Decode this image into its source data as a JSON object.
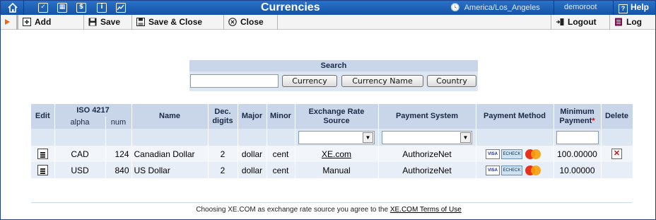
{
  "topbar": {
    "icons": [
      "home-icon",
      "checkbox-icon",
      "grid-icon",
      "dollar-icon",
      "info-icon",
      "chart-icon"
    ],
    "title": "Currencies",
    "timezone": "America/Los_Angeles",
    "user": "demoroot",
    "help": "Help",
    "background": "#1a5fb4"
  },
  "toolbar": {
    "add": "Add",
    "save": "Save",
    "save_close": "Save & Close",
    "close": "Close",
    "logout": "Logout",
    "log": "Log",
    "accent": "#e86a0c"
  },
  "search": {
    "title": "Search",
    "input_value": "",
    "buttons": [
      "Currency",
      "Currency Name",
      "Country"
    ]
  },
  "table": {
    "headers": {
      "edit": "Edit",
      "iso": "ISO 4217",
      "alpha": "alpha",
      "num": "num",
      "name": "Name",
      "dec": "Dec. digits",
      "major": "Major",
      "minor": "Minor",
      "rate_source": "Exchange Rate Source",
      "payment_system": "Payment System",
      "payment_method": "Payment Method",
      "minimum_payment": "Minimum Payment",
      "required_mark": "*",
      "delete": "Delete"
    },
    "rows": [
      {
        "alpha": "CAD",
        "num": "124",
        "name": "Canadian Dollar",
        "dec": "2",
        "major": "dollar",
        "minor": "cent",
        "rate_source": "XE.com",
        "payment_system": "AuthorizeNet",
        "minimum_payment": "100.00000",
        "deletable": true
      },
      {
        "alpha": "USD",
        "num": "840",
        "name": "US Dollar",
        "dec": "2",
        "major": "dollar",
        "minor": "cent",
        "rate_source": "Manual",
        "payment_system": "AuthorizeNet",
        "minimum_payment": "10.00000",
        "deletable": false
      }
    ],
    "payment_method_labels": {
      "visa": "VISA",
      "echeck": "ECHECK"
    }
  },
  "footer": {
    "text": "Choosing XE.COM as exchange rate source you agree to the",
    "link": "XE.COM Terms of Use"
  }
}
